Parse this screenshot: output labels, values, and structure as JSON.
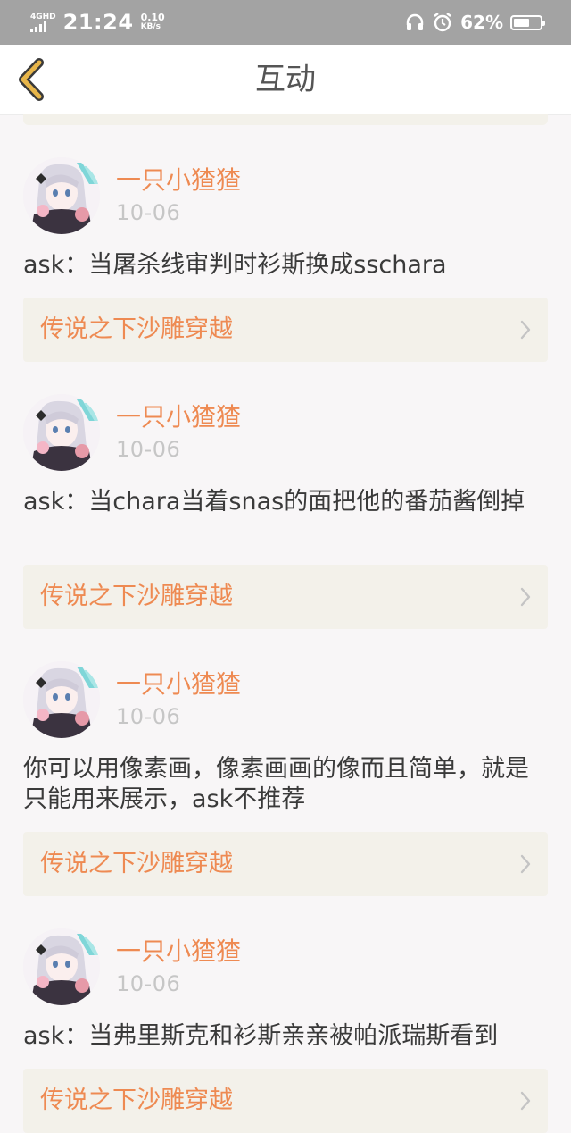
{
  "status_bar": {
    "network": "4GHD",
    "time": "21:24",
    "speed_value": "0.10",
    "speed_unit": "KB/s",
    "battery_percent": "62%",
    "battery_level": 0.62,
    "icons": [
      "signal-icon",
      "headphones-icon",
      "alarm-icon",
      "battery-icon"
    ]
  },
  "header": {
    "title": "互动",
    "back_icon": "chevron-left-icon",
    "accent_color": "#e8b64a"
  },
  "colors": {
    "author": "#ee8a52",
    "topic": "#ee8a52",
    "date": "#c6c6c6",
    "card_bg": "#f3f1ea"
  },
  "posts": [
    {
      "author": "一只小猹猹",
      "date": "10-06",
      "text": "ask：当屠杀线审判时衫斯换成sschara",
      "topic": "传说之下沙雕穿越"
    },
    {
      "author": "一只小猹猹",
      "date": "10-06",
      "text": "ask：当chara当着snas的面把他的番茄酱倒掉",
      "topic": "传说之下沙雕穿越"
    },
    {
      "author": "一只小猹猹",
      "date": "10-06",
      "text": "你可以用像素画，像素画画的像而且简单，就是只能用来展示，ask不推荐",
      "topic": "传说之下沙雕穿越"
    },
    {
      "author": "一只小猹猹",
      "date": "10-06",
      "text": "ask：当弗里斯克和衫斯亲亲被帕派瑞斯看到",
      "topic": "传说之下沙雕穿越"
    }
  ]
}
